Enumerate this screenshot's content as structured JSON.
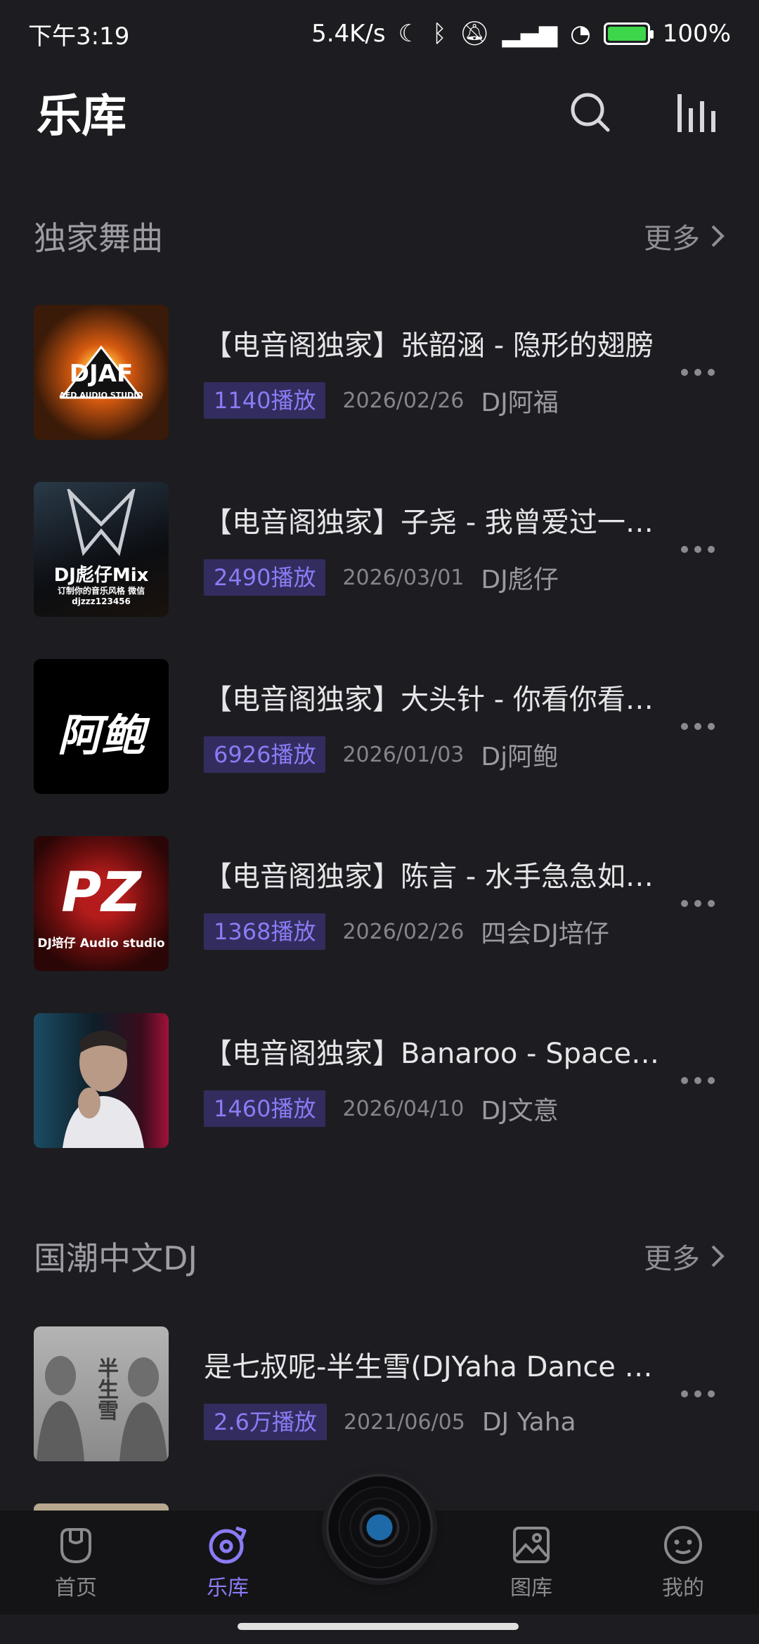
{
  "status": {
    "time": "下午3:19",
    "speed": "5.4K/s",
    "battery": "100%"
  },
  "header": {
    "title": "乐库"
  },
  "sections": [
    {
      "title": "独家舞曲",
      "more": "更多",
      "tracks": [
        {
          "title": "【电音阁独家】张韶涵 - 隐形的翅膀",
          "plays": "1140播放",
          "date": "2026/02/26",
          "artist": "DJ阿福",
          "cover_text": "DJAF",
          "cover_sub": "AFD AUDIO STUDIO",
          "cover_color": "#3a1a08"
        },
        {
          "title": "【电音阁独家】子尧 - 我曾爱过一个人",
          "plays": "2490播放",
          "date": "2026/03/01",
          "artist": "DJ彪仔",
          "cover_text": "DJ彪仔Mix",
          "cover_sub": "订制你的音乐风格 微信djzzz123456",
          "cover_color": "#12161c"
        },
        {
          "title": "【电音阁独家】大头针 - 你看你看月亮的脸",
          "plays": "6926播放",
          "date": "2026/01/03",
          "artist": "Dj阿鲍",
          "cover_text": "阿鲍",
          "cover_sub": "",
          "cover_color": "#000000"
        },
        {
          "title": "【电音阁独家】陈言 - 水手急急如律令",
          "plays": "1368播放",
          "date": "2026/02/26",
          "artist": "四会DJ培仔",
          "cover_text": "PZ",
          "cover_sub": "DJ培仔 Audio studio",
          "cover_color": "#5a0c0c"
        },
        {
          "title": "【电音阁独家】Banaroo - Space Cowboy",
          "plays": "1460播放",
          "date": "2026/04/10",
          "artist": "DJ文意",
          "cover_text": "",
          "cover_sub": "",
          "cover_color": "#1c3a48"
        }
      ]
    },
    {
      "title": "国潮中文DJ",
      "more": "更多",
      "tracks": [
        {
          "title": "是七叔呢-半生雪(DJYaha Dance Mix)",
          "plays": "2.6万播放",
          "date": "2021/06/05",
          "artist": "DJ Yaha",
          "cover_text": "半生雪",
          "cover_sub": "",
          "cover_color": "#9a9a9a"
        }
      ]
    }
  ],
  "tabs": [
    {
      "label": "首页",
      "icon": "home-icon",
      "active": false
    },
    {
      "label": "乐库",
      "icon": "music-library-icon",
      "active": true
    },
    {
      "label": "图库",
      "icon": "gallery-icon",
      "active": false
    },
    {
      "label": "我的",
      "icon": "profile-icon",
      "active": false
    }
  ],
  "colors": {
    "accent": "#8a7cf5",
    "background": "#1d1d21",
    "tabbar": "#141416"
  }
}
